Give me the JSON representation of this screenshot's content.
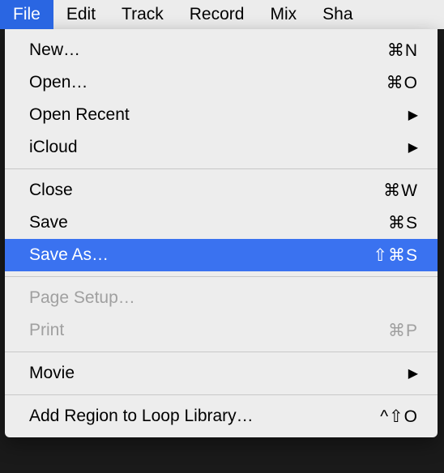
{
  "menubar": {
    "items": [
      {
        "label": "File",
        "active": true
      },
      {
        "label": "Edit",
        "active": false
      },
      {
        "label": "Track",
        "active": false
      },
      {
        "label": "Record",
        "active": false
      },
      {
        "label": "Mix",
        "active": false
      },
      {
        "label": "Sha",
        "active": false
      }
    ]
  },
  "menu": {
    "new": {
      "label": "New…",
      "shortcut": "⌘N"
    },
    "open": {
      "label": "Open…",
      "shortcut": "⌘O"
    },
    "open_recent": {
      "label": "Open Recent"
    },
    "icloud": {
      "label": "iCloud"
    },
    "close": {
      "label": "Close",
      "shortcut": "⌘W"
    },
    "save": {
      "label": "Save",
      "shortcut": "⌘S"
    },
    "save_as": {
      "label": "Save As…",
      "shortcut": "⇧⌘S"
    },
    "page_setup": {
      "label": "Page Setup…"
    },
    "print": {
      "label": "Print",
      "shortcut": "⌘P"
    },
    "movie": {
      "label": "Movie"
    },
    "add_region": {
      "label": "Add Region to Loop Library…",
      "shortcut": "^⇧O"
    }
  }
}
